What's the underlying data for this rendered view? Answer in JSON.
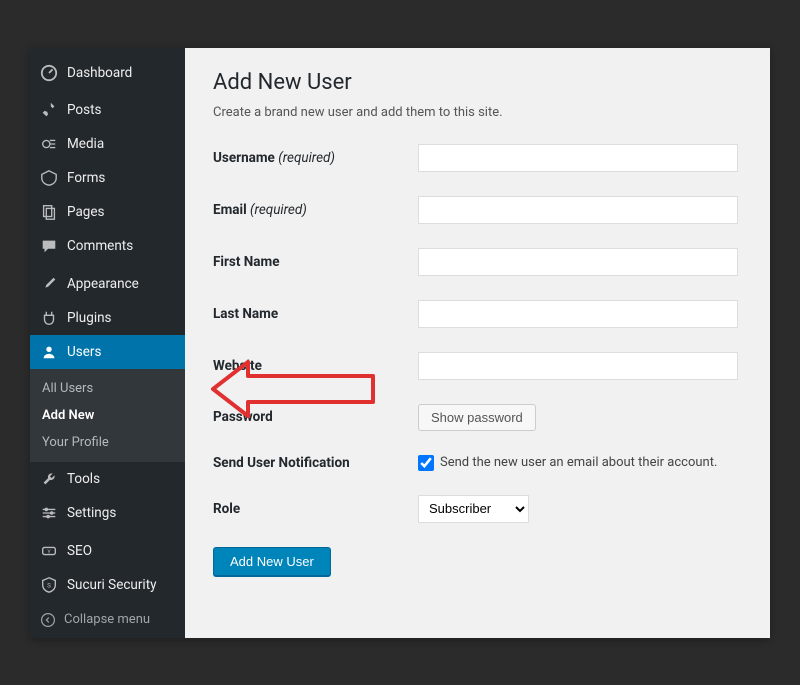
{
  "sidebar": {
    "items": [
      {
        "label": "Dashboard",
        "icon": "dashboard-icon"
      },
      {
        "label": "Posts",
        "icon": "pin-icon"
      },
      {
        "label": "Media",
        "icon": "media-icon"
      },
      {
        "label": "Forms",
        "icon": "forms-icon"
      },
      {
        "label": "Pages",
        "icon": "pages-icon"
      },
      {
        "label": "Comments",
        "icon": "comments-icon"
      },
      {
        "label": "Appearance",
        "icon": "brush-icon"
      },
      {
        "label": "Plugins",
        "icon": "plug-icon"
      },
      {
        "label": "Users",
        "icon": "user-icon"
      },
      {
        "label": "Tools",
        "icon": "wrench-icon"
      },
      {
        "label": "Settings",
        "icon": "sliders-icon"
      },
      {
        "label": "SEO",
        "icon": "seo-icon"
      },
      {
        "label": "Sucuri Security",
        "icon": "shield-icon"
      }
    ],
    "submenu": {
      "items": [
        {
          "label": "All Users"
        },
        {
          "label": "Add New"
        },
        {
          "label": "Your Profile"
        }
      ]
    },
    "collapse_label": "Collapse menu"
  },
  "page": {
    "title": "Add New User",
    "subtitle": "Create a brand new user and add them to this site."
  },
  "form": {
    "username_label": "Username",
    "email_label": "Email",
    "firstname_label": "First Name",
    "lastname_label": "Last Name",
    "website_label": "Website",
    "password_label": "Password",
    "notification_label": "Send User Notification",
    "role_label": "Role",
    "required_text": "(required)",
    "show_password_btn": "Show password",
    "notification_text": "Send the new user an email about their account.",
    "notification_checked": true,
    "role_value": "Subscriber",
    "submit_label": "Add New User"
  }
}
